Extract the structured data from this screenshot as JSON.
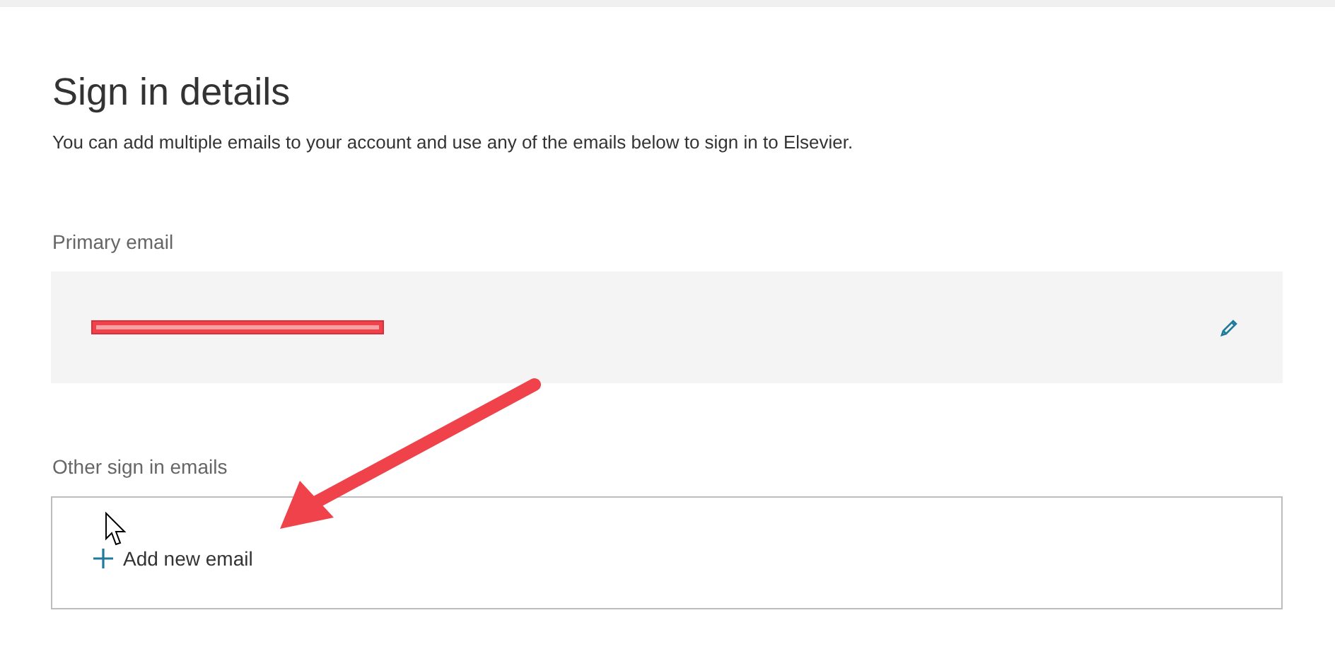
{
  "heading": "Sign in details",
  "description": "You can add multiple emails to your account and use any of the emails below to sign in to Elsevier.",
  "primary_email": {
    "label": "Primary email",
    "redacted": true
  },
  "other_emails": {
    "label": "Other sign in emails",
    "add_action": "Add new email"
  }
}
